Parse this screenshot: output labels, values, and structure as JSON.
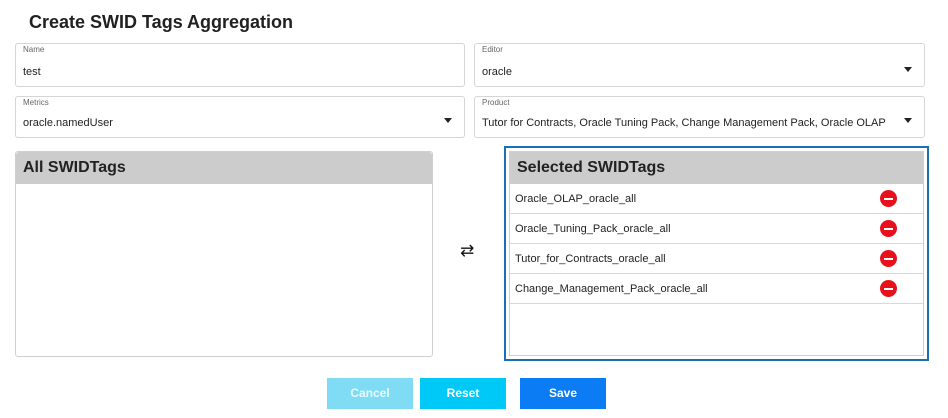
{
  "page": {
    "title": "Create SWID Tags Aggregation"
  },
  "form": {
    "name": {
      "label": "Name",
      "value": "test"
    },
    "editor": {
      "label": "Editor",
      "value": "oracle"
    },
    "metrics": {
      "label": "Metrics",
      "value": "oracle.namedUser"
    },
    "product": {
      "label": "Product",
      "value": "Tutor for Contracts, Oracle Tuning Pack, Change Management Pack, Oracle OLAP"
    }
  },
  "all_panel": {
    "title": "All SWIDTags",
    "items": []
  },
  "selected_panel": {
    "title": "Selected SWIDTags",
    "items": [
      {
        "label": "Oracle_OLAP_oracle_all"
      },
      {
        "label": "Oracle_Tuning_Pack_oracle_all"
      },
      {
        "label": "Tutor_for_Contracts_oracle_all"
      },
      {
        "label": "Change_Management_Pack_oracle_all"
      }
    ]
  },
  "transfer": {
    "icon": "⇄",
    "icon_name": "swap-arrows-icon"
  },
  "buttons": {
    "cancel": "Cancel",
    "reset": "Reset",
    "save": "Save"
  },
  "colors": {
    "accent_border": "#1a6fb5",
    "remove_icon": "#e8101b",
    "cancel_button": "#7fdcf4",
    "reset_button": "#00c9f7",
    "save_button": "#0b7cf3"
  }
}
